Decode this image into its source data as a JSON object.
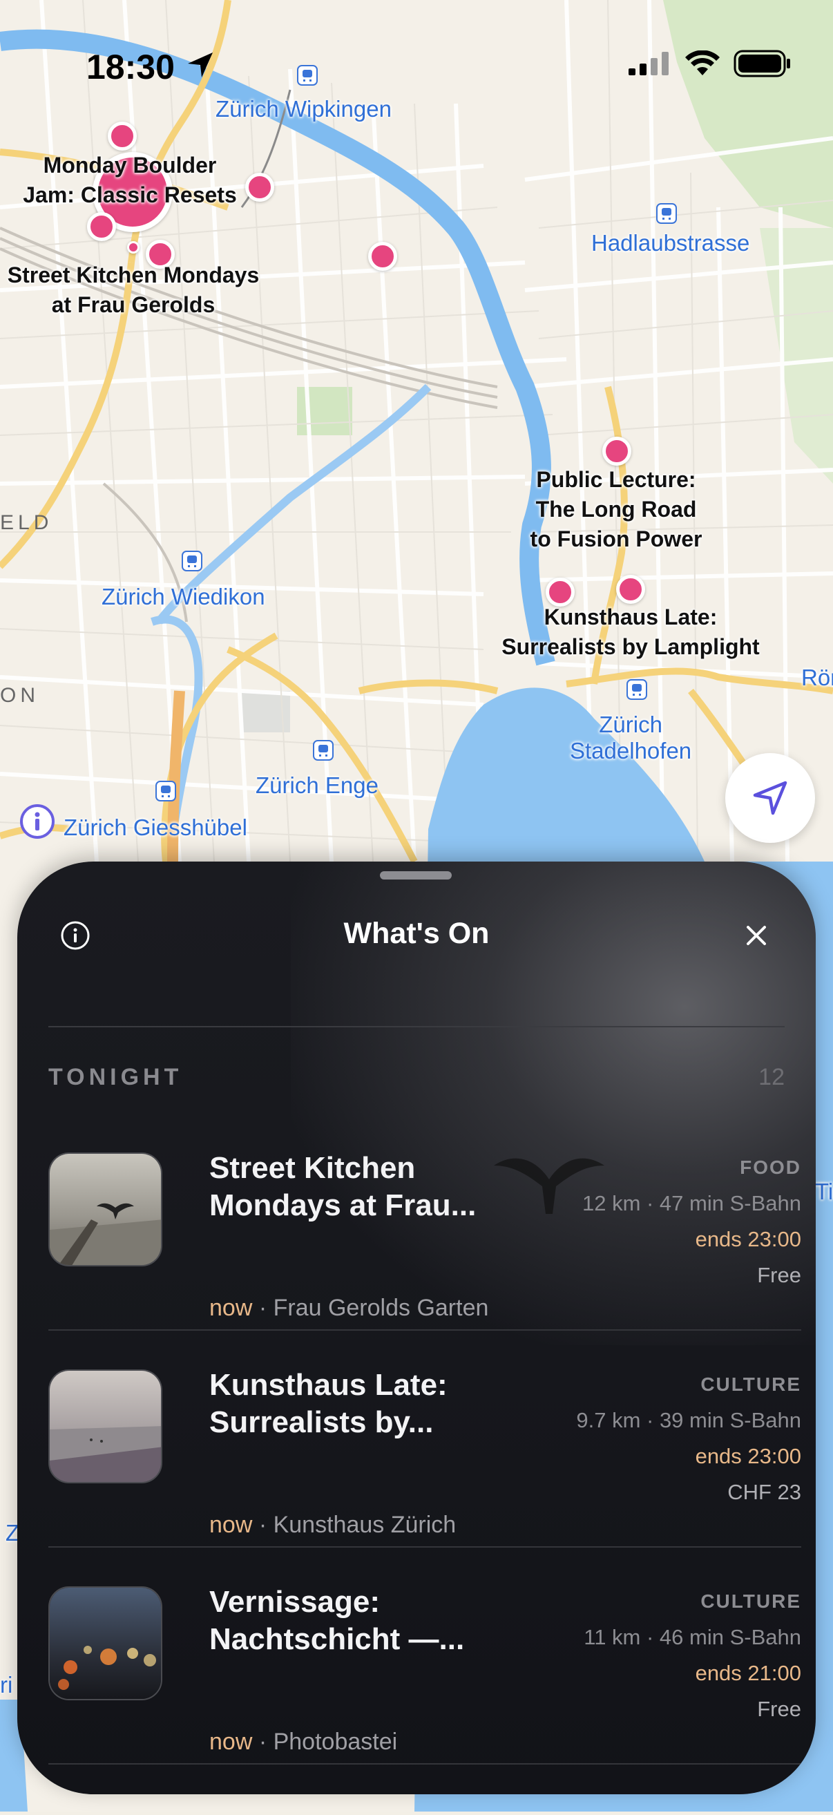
{
  "status_bar": {
    "time": "18:30"
  },
  "map": {
    "stations": [
      {
        "label": "Zürich Wipkingen"
      },
      {
        "label": "Hadlaubstrasse"
      },
      {
        "label": "Zürich Wiedikon"
      },
      {
        "label": "Zürich Enge"
      },
      {
        "label": "Zürich\nStadelhofen"
      },
      {
        "label": "Zürich Giesshübel"
      }
    ],
    "event_labels": [
      {
        "label": "Monday Boulder\nJam: Classic Resets"
      },
      {
        "label": "Street Kitchen Mondays\nat Frau Gerolds"
      },
      {
        "label": "Public Lecture:\nThe Long Road\nto Fusion Power"
      },
      {
        "label": "Kunsthaus Late:\nSurrealists by Lamplight"
      }
    ],
    "edge_labels": {
      "left": "ELD",
      "left2": "ON",
      "right": "Rön",
      "right2": "Ti",
      "left3": "Z",
      "left4": "ri"
    },
    "accent": "#e6457f"
  },
  "sheet": {
    "title": "What's On",
    "section": {
      "label": "TONIGHT",
      "count": "12"
    },
    "events": [
      {
        "title": "Street Kitchen Mondays at Frau...",
        "category": "FOOD",
        "distance": "12 km · 47 min S-Bahn",
        "ends": "ends 23:00",
        "price": "Free",
        "status": "now",
        "venue": "· Frau Gerolds Garten"
      },
      {
        "title": "Kunsthaus Late: Surrealists by...",
        "category": "CULTURE",
        "distance": "9.7 km · 39 min S-Bahn",
        "ends": "ends 23:00",
        "price": "CHF 23",
        "status": "now",
        "venue": "· Kunsthaus Zürich"
      },
      {
        "title": "Vernissage: Nachtschicht —...",
        "category": "CULTURE",
        "distance": "11 km · 46 min S-Bahn",
        "ends": "ends 21:00",
        "price": "Free",
        "status": "now",
        "venue": "· Photobastei"
      }
    ]
  }
}
